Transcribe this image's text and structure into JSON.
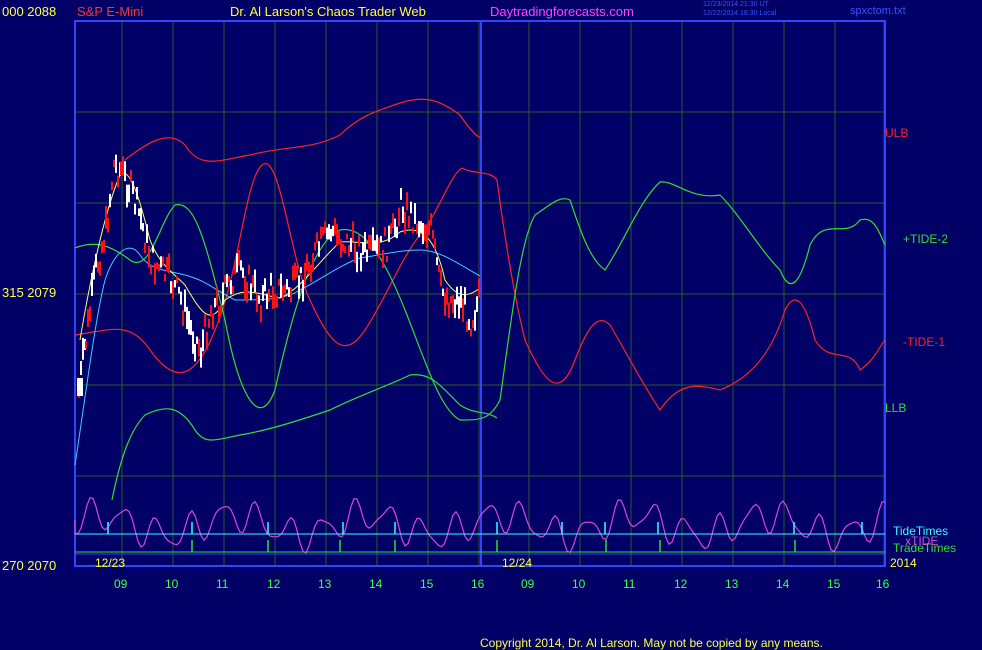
{
  "header": {
    "price_top": "000  2088",
    "instrument": "S&P E-Mini",
    "site_title": "Dr. Al Larson's Chaos Trader Web",
    "site_url": "Daytradingforecasts.com",
    "stamp1": "12/23/2014 21:30 UT",
    "stamp2": "12/22/2014 16:30 Local",
    "filename": "spxctom.txt"
  },
  "left_scale": {
    "mid_label": "315  2079",
    "bottom_label": "270  2070"
  },
  "right_labels": {
    "ulb": "ULB",
    "tide2": "+TIDE-2",
    "tide1": "-TIDE-1",
    "llb": "LLB",
    "tidetimes": "TideTimes",
    "xtide": "xTIDE",
    "tradetimes": "TradeTimes"
  },
  "date_labels": {
    "d1": "12/23",
    "d2": "12/24",
    "year": "2014"
  },
  "hour_labels": [
    "09",
    "10",
    "11",
    "12",
    "13",
    "14",
    "15",
    "16",
    "09",
    "10",
    "11",
    "12",
    "13",
    "14",
    "15",
    "16"
  ],
  "footer": {
    "copyright": "Copyright 2014, Dr. Al Larson. May not be copied by any means."
  },
  "colors": {
    "background": "#000066",
    "frame": "#3344ff",
    "price_up": "#ffffff",
    "price_down": "#ff1111",
    "ulb_llb_red": "#ff2222",
    "tide_green": "#33dd33",
    "tide_times_cyan": "#33ffff",
    "xtide_magenta": "#dd44dd",
    "avg_yellow": "#ffff66",
    "avg_cyan": "#44ccff",
    "title_yellow": "#ffff44",
    "url_magenta": "#ff44ff",
    "hours_green": "#44ff44"
  },
  "chart_data": {
    "type": "line",
    "title": "S&P E-Mini",
    "y_range": [
      2070,
      2088
    ],
    "y_ticks": [
      2070,
      2079,
      2088
    ],
    "x_dates": [
      "12/23",
      "12/24"
    ],
    "x_hours": [
      "09",
      "10",
      "11",
      "12",
      "13",
      "14",
      "15",
      "16",
      "09",
      "10",
      "11",
      "12",
      "13",
      "14",
      "15",
      "16"
    ],
    "series": [
      {
        "name": "ULB",
        "color": "#ff2222"
      },
      {
        "name": "+TIDE-2",
        "color": "#33dd33"
      },
      {
        "name": "-TIDE-1",
        "color": "#ff2222"
      },
      {
        "name": "LLB",
        "color": "#33dd33"
      },
      {
        "name": "TideTimes",
        "color": "#33ffff"
      },
      {
        "name": "xTIDE",
        "color": "#dd44dd"
      },
      {
        "name": "TradeTimes",
        "color": "#33dd33"
      }
    ]
  }
}
